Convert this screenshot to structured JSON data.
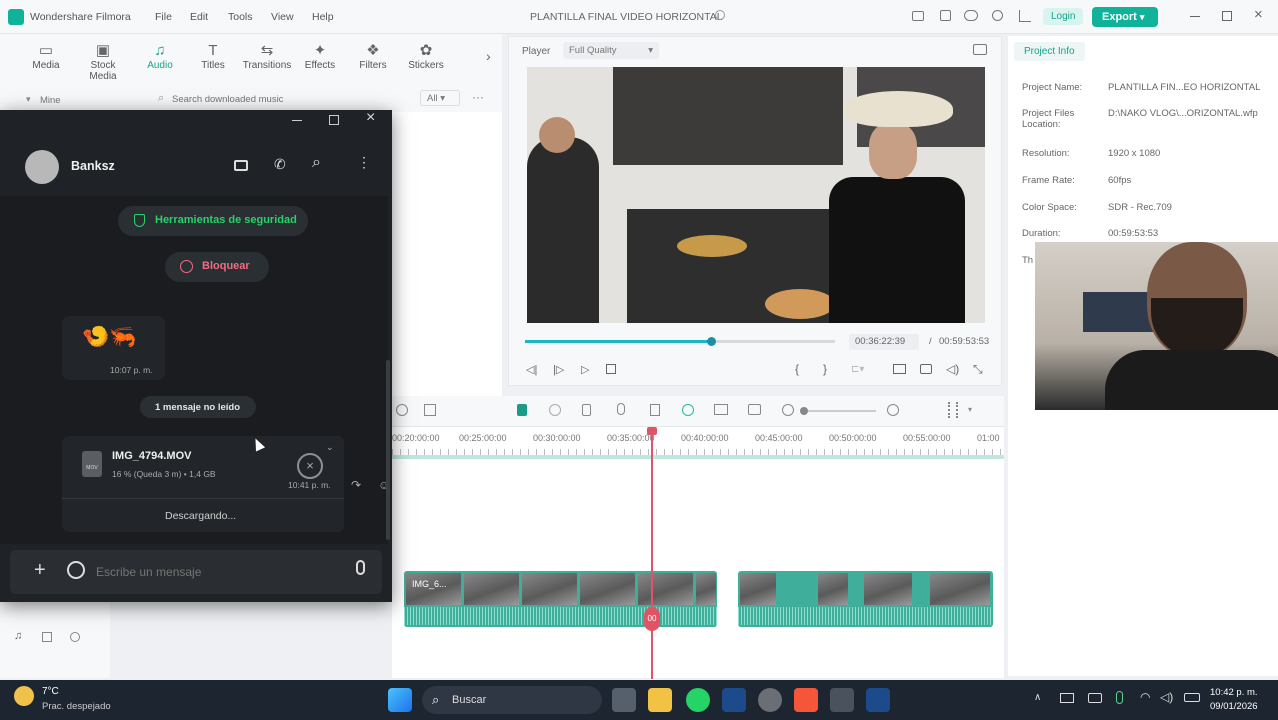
{
  "app": {
    "name": "Wondershare Filmora",
    "menu": [
      "File",
      "Edit",
      "Tools",
      "View",
      "Help"
    ],
    "project_title": "PLANTILLA FINAL VIDEO HORIZONTAL",
    "login_label": "Login",
    "export_label": "Export"
  },
  "toolbar": {
    "tools": [
      {
        "label": "Media",
        "icon": "media-icon",
        "active": false
      },
      {
        "label": "Stock Media",
        "icon": "stock-media-icon",
        "active": false
      },
      {
        "label": "Audio",
        "icon": "music-note-icon",
        "active": true
      },
      {
        "label": "Titles",
        "icon": "titles-icon",
        "active": false
      },
      {
        "label": "Transitions",
        "icon": "transitions-icon",
        "active": false
      },
      {
        "label": "Effects",
        "icon": "effects-icon",
        "active": false
      },
      {
        "label": "Filters",
        "icon": "filters-icon",
        "active": false
      },
      {
        "label": "Stickers",
        "icon": "stickers-icon",
        "active": false
      }
    ],
    "mine_label": "Mine",
    "search_placeholder": "Search downloaded music",
    "filter_value": "All"
  },
  "player": {
    "label": "Player",
    "quality": "Full Quality",
    "current_time": "00:36:22:39",
    "separator": "/",
    "total_time": "00:59:53:53",
    "progress": 0.6
  },
  "project_info": {
    "tab": "Project Info",
    "rows": [
      {
        "key": "Project Name:",
        "value": "PLANTILLA FIN...EO HORIZONTAL"
      },
      {
        "key": "Project Files Location:",
        "value": "D:\\NAKO VLOG\\...ORIZONTAL.wfp"
      },
      {
        "key": "Resolution:",
        "value": "1920 x 1080"
      },
      {
        "key": "Frame Rate:",
        "value": "60fps"
      },
      {
        "key": "Color Space:",
        "value": "SDR - Rec.709"
      },
      {
        "key": "Duration:",
        "value": "00:59:53:53"
      },
      {
        "key": "Th",
        "value": ""
      }
    ]
  },
  "timeline": {
    "ticks": [
      "00:20:00:00",
      "00:25:00:00",
      "00:30:00:00",
      "00:35:00:00",
      "00:40:00:00",
      "00:45:00:00",
      "00:50:00:00",
      "00:55:00:00",
      "01:00"
    ],
    "clip_label": "IMG_6...",
    "playhead_badge": "00"
  },
  "chat": {
    "contact": "Banksz",
    "security_label": "Herramientas de seguridad",
    "block_label": "Bloquear",
    "emoji_message": "🍤🦐",
    "emoji_time": "10:07 p. m.",
    "unread_label": "1 mensaje no leído",
    "file_name": "IMG_4794.MOV",
    "file_progress": "16 % (Queda 3 m) • 1,4 GB",
    "file_time": "10:41 p. m.",
    "downloading_label": "Descargando...",
    "input_placeholder": "Escribe un mensaje",
    "file_badge": "MOV"
  },
  "taskbar": {
    "temperature": "7°C",
    "weather": "Prac. despejado",
    "search_label": "Buscar",
    "time": "10:42 p. m.",
    "date": "09/01/2026"
  },
  "colors": {
    "accent": "#10b39a",
    "playhead": "#e05565",
    "chat_bg": "#1f2226",
    "whatsapp_green": "#25d366"
  }
}
